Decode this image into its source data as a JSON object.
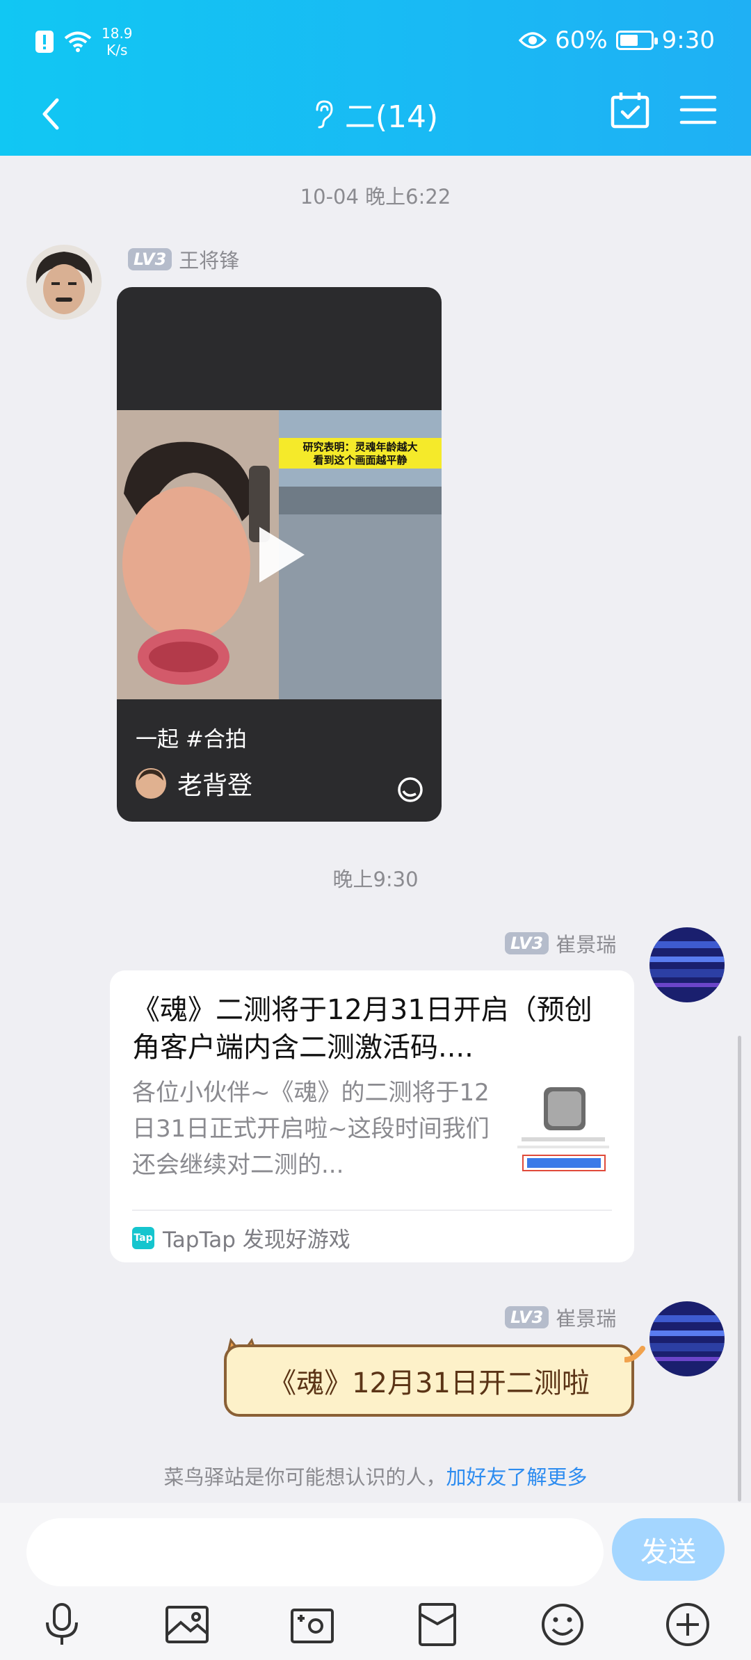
{
  "status_bar": {
    "speed_value": "18.9",
    "speed_unit": "K/s",
    "battery": "60%",
    "battery_level": 0.6,
    "time": "9:30"
  },
  "nav": {
    "title": "二(14)"
  },
  "messages": [
    {
      "time": "10-04 晚上6:22",
      "level": "LV3",
      "sender": "王将锋",
      "video": {
        "caption": "一起 #合拍",
        "author": "老背登",
        "banner_line1": "研究表明：灵魂年龄越大",
        "banner_line2": "看到这个画面越平静"
      }
    },
    {
      "time": "晚上9:30",
      "level": "LV3",
      "sender": "崔景瑞",
      "link": {
        "title": "《魂》二测将于12月31日开启（预创角客户端内含二测激活码....",
        "desc": "各位小伙伴~《魂》的二测将于12日31日正式开启啦~这段时间我们还会继续对二测的...",
        "source": "TapTap 发现好游戏",
        "tap_logo": "Tap"
      }
    },
    {
      "level": "LV3",
      "sender": "崔景瑞",
      "text": "《魂》12月31日开二测啦"
    }
  ],
  "notice": {
    "text": "菜鸟驿站是你可能想认识的人，",
    "link": "加好友了解更多"
  },
  "input": {
    "placeholder": "",
    "send": "发送"
  },
  "colors": {
    "header": "#11c7f3",
    "send": "#a4d6ff",
    "link": "#2d8cf0"
  }
}
